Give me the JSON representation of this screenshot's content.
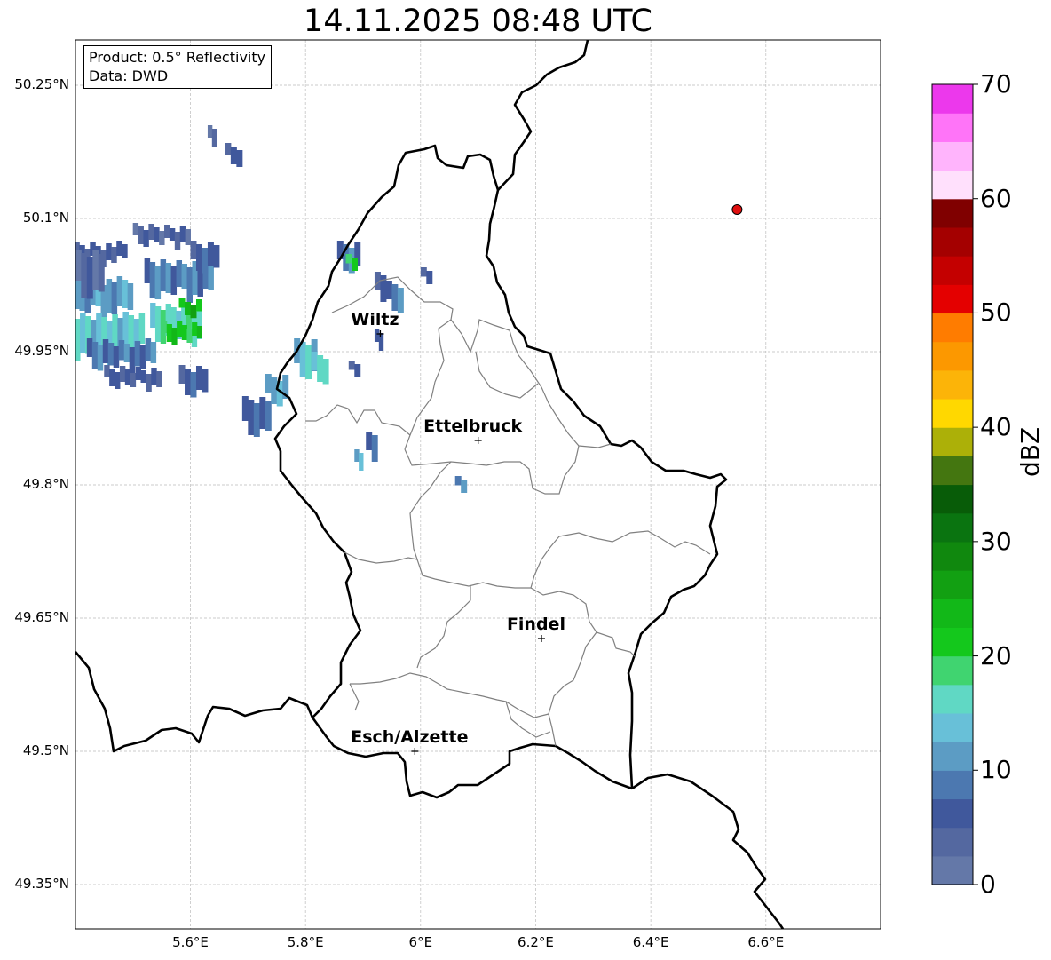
{
  "title": "14.11.2025 08:48 UTC",
  "info": {
    "product": "Product: 0.5° Reflectivity",
    "data": "Data: DWD"
  },
  "axes": {
    "lon_ticks": [
      "5.6°E",
      "5.8°E",
      "6°E",
      "6.2°E",
      "6.4°E",
      "6.6°E"
    ],
    "lat_ticks": [
      "50.25°N",
      "50.1°N",
      "49.95°N",
      "49.8°N",
      "49.65°N",
      "49.5°N",
      "49.35°N"
    ],
    "grid": true
  },
  "cities": [
    {
      "name": "Wiltz",
      "lon": 5.93,
      "lat": 49.97
    },
    {
      "name": "Ettelbruck",
      "lon": 6.1,
      "lat": 49.85
    },
    {
      "name": "Findel",
      "lon": 6.21,
      "lat": 49.627
    },
    {
      "name": "Esch/Alzette",
      "lon": 5.99,
      "lat": 49.5
    }
  ],
  "marker": {
    "lon": 6.55,
    "lat": 50.11,
    "color": "#e01010"
  },
  "colorbar": {
    "label": "dBZ",
    "ticks": [
      "0",
      "10",
      "20",
      "30",
      "40",
      "50",
      "60",
      "70"
    ],
    "min": 0,
    "max": 70,
    "step": 2.5,
    "colors": [
      "#6478a8",
      "#5468a0",
      "#40589c",
      "#4c78b0",
      "#5c9cc4",
      "#68c0d8",
      "#60d8c4",
      "#40d470",
      "#14c81c",
      "#12b818",
      "#12a012",
      "#10880e",
      "#0a7410",
      "#085c08",
      "#447610",
      "#acb008",
      "#ffd800",
      "#fcb408",
      "#fc9800",
      "#ff7c00",
      "#e40000",
      "#c40000",
      "#a40000",
      "#800000",
      "#ffe0fc",
      "#ffb4fc",
      "#ff74f8",
      "#ec38ec"
    ]
  },
  "echoes": [
    {
      "lon": 5.37,
      "lat": 50.07,
      "w": 0.12,
      "h": 0.02,
      "dbz": 5
    },
    {
      "lon": 5.37,
      "lat": 50.03,
      "w": 0.13,
      "h": 0.04,
      "dbz": 11
    },
    {
      "lon": 5.38,
      "lat": 49.99,
      "w": 0.14,
      "h": 0.05,
      "dbz": 14
    },
    {
      "lon": 5.42,
      "lat": 49.96,
      "w": 0.12,
      "h": 0.03,
      "dbz": 8
    },
    {
      "lon": 5.45,
      "lat": 49.93,
      "w": 0.1,
      "h": 0.02,
      "dbz": 5
    },
    {
      "lon": 5.5,
      "lat": 50.09,
      "w": 0.1,
      "h": 0.02,
      "dbz": 4
    },
    {
      "lon": 5.52,
      "lat": 50.05,
      "w": 0.12,
      "h": 0.04,
      "dbz": 9
    },
    {
      "lon": 5.53,
      "lat": 50.0,
      "w": 0.09,
      "h": 0.04,
      "dbz": 16
    },
    {
      "lon": 5.55,
      "lat": 49.98,
      "w": 0.07,
      "h": 0.02,
      "dbz": 21
    },
    {
      "lon": 5.58,
      "lat": 50.005,
      "w": 0.04,
      "h": 0.015,
      "dbz": 23
    },
    {
      "lon": 5.6,
      "lat": 50.07,
      "w": 0.05,
      "h": 0.03,
      "dbz": 6
    },
    {
      "lon": 5.58,
      "lat": 49.93,
      "w": 0.05,
      "h": 0.03,
      "dbz": 6
    },
    {
      "lon": 5.69,
      "lat": 49.895,
      "w": 0.05,
      "h": 0.04,
      "dbz": 7
    },
    {
      "lon": 5.73,
      "lat": 49.92,
      "w": 0.04,
      "h": 0.03,
      "dbz": 12
    },
    {
      "lon": 5.78,
      "lat": 49.96,
      "w": 0.04,
      "h": 0.04,
      "dbz": 13
    },
    {
      "lon": 5.81,
      "lat": 49.945,
      "w": 0.03,
      "h": 0.03,
      "dbz": 15
    },
    {
      "lon": 5.4,
      "lat": 50.06,
      "w": 0.05,
      "h": 0.05,
      "dbz": 3
    },
    {
      "lon": 5.63,
      "lat": 50.2,
      "w": 0.015,
      "h": 0.02,
      "dbz": 4
    },
    {
      "lon": 5.66,
      "lat": 50.18,
      "w": 0.03,
      "h": 0.02,
      "dbz": 5
    },
    {
      "lon": 5.855,
      "lat": 50.07,
      "w": 0.04,
      "h": 0.03,
      "dbz": 8
    },
    {
      "lon": 5.87,
      "lat": 50.055,
      "w": 0.02,
      "h": 0.015,
      "dbz": 20
    },
    {
      "lon": 5.92,
      "lat": 50.035,
      "w": 0.02,
      "h": 0.03,
      "dbz": 6
    },
    {
      "lon": 5.92,
      "lat": 49.97,
      "w": 0.015,
      "h": 0.02,
      "dbz": 7
    },
    {
      "lon": 5.94,
      "lat": 50.025,
      "w": 0.03,
      "h": 0.03,
      "dbz": 8
    },
    {
      "lon": 6.0,
      "lat": 50.04,
      "w": 0.02,
      "h": 0.015,
      "dbz": 6
    },
    {
      "lon": 5.875,
      "lat": 49.935,
      "w": 0.02,
      "h": 0.015,
      "dbz": 6
    },
    {
      "lon": 5.905,
      "lat": 49.855,
      "w": 0.02,
      "h": 0.03,
      "dbz": 9
    },
    {
      "lon": 5.885,
      "lat": 49.835,
      "w": 0.015,
      "h": 0.02,
      "dbz": 13
    },
    {
      "lon": 6.06,
      "lat": 49.805,
      "w": 0.02,
      "h": 0.015,
      "dbz": 10
    }
  ]
}
